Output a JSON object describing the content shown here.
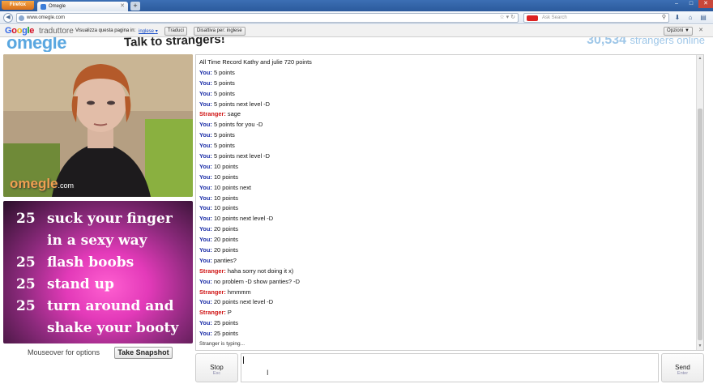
{
  "browser": {
    "app_button": "Firefox",
    "tab_title": "Omegle",
    "new_tab": "+",
    "url": "www.omegle.com",
    "search_placeholder": "Ask Search",
    "win_min": "–",
    "win_max": "□",
    "win_close": "✕"
  },
  "translate_bar": {
    "logo_parts": [
      "G",
      "o",
      "o",
      "g",
      "l",
      "e"
    ],
    "product": "traduttore",
    "visualizza_label": "Visualizza questa pagina in:",
    "language": "inglese",
    "language_arrow": "▾",
    "translate_button": "Traduci",
    "disable_button": "Disattiva per: inglese",
    "options_button": "Opzioni ▼",
    "close": "✕"
  },
  "omegle_header": {
    "logo": "omegle",
    "tagline": "Talk to strangers!",
    "online_count": "30,534",
    "online_label": "strangers online"
  },
  "stranger_video": {
    "watermark": "omegle",
    "watermark_suffix": ".com"
  },
  "self_video": {
    "tasks": [
      {
        "points": "25",
        "text": "suck your finger"
      },
      {
        "points": "",
        "text": "in a sexy way"
      },
      {
        "points": "25",
        "text": "flash boobs"
      },
      {
        "points": "25",
        "text": "stand up"
      },
      {
        "points": "25",
        "text": "turn around and"
      },
      {
        "points": "",
        "text": "shake your booty"
      }
    ]
  },
  "video_controls": {
    "mouseover_label": "Mouseover for options",
    "snapshot_button": "Take Snapshot"
  },
  "chat": {
    "header_line": "All Time Record  Kathy and julie 720 points",
    "messages": [
      {
        "who": "You",
        "text": "5 points"
      },
      {
        "who": "You",
        "text": "5 points"
      },
      {
        "who": "You",
        "text": "5 points"
      },
      {
        "who": "You",
        "text": "5 points next level  -D"
      },
      {
        "who": "Stranger",
        "text": "sage"
      },
      {
        "who": "You",
        "text": "5 points for you  -D"
      },
      {
        "who": "You",
        "text": "5 points"
      },
      {
        "who": "You",
        "text": "5 points"
      },
      {
        "who": "You",
        "text": "5 points next level  -D"
      },
      {
        "who": "You",
        "text": "10 points"
      },
      {
        "who": "You",
        "text": "10 points"
      },
      {
        "who": "You",
        "text": "10 points next"
      },
      {
        "who": "You",
        "text": "10 points"
      },
      {
        "who": "You",
        "text": "10 points"
      },
      {
        "who": "You",
        "text": "10 points next level  -D"
      },
      {
        "who": "You",
        "text": "20 points"
      },
      {
        "who": "You",
        "text": "20 points"
      },
      {
        "who": "You",
        "text": "20 points"
      },
      {
        "who": "You",
        "text": "panties?"
      },
      {
        "who": "Stranger",
        "text": "haha sorry not doing it x)"
      },
      {
        "who": "You",
        "text": "no problem  -D show panties?  -D"
      },
      {
        "who": "Stranger",
        "text": "hmmmm"
      },
      {
        "who": "You",
        "text": "20 points next level  -D"
      },
      {
        "who": "Stranger",
        "text": "P"
      },
      {
        "who": "You",
        "text": "25 points"
      },
      {
        "who": "You",
        "text": "25 points"
      }
    ],
    "typing_status": "Stranger is typing..."
  },
  "controls": {
    "stop_label": "Stop",
    "stop_key": "Esc",
    "message_value": "",
    "send_label": "Send",
    "send_key": "Enter"
  },
  "colors": {
    "you_color": "#1c2ea8",
    "stranger_color": "#d01515",
    "omegle_blue": "#5aa7e0"
  }
}
